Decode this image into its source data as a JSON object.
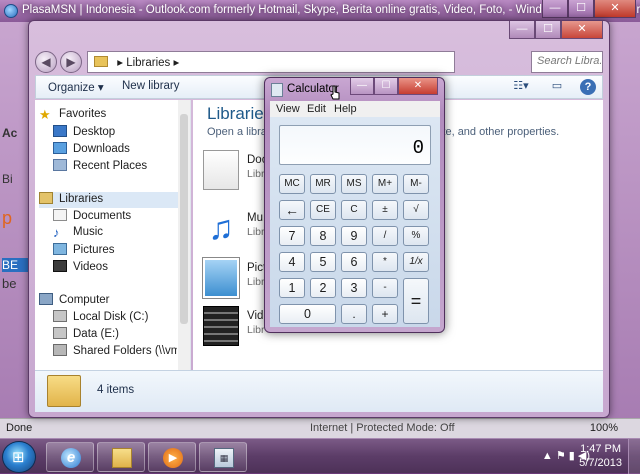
{
  "ie": {
    "title": "PlasaMSN | Indonesia - Outlook.com formerly Hotmail, Skype, Berita online gratis, Video, Foto,  - Windows Internet Explorer",
    "buttons": {
      "minimize": "—",
      "maximize": "☐",
      "close": "✕"
    },
    "left_fragments": [
      "Ac",
      "Bi",
      "p",
      "BE",
      "be"
    ],
    "status": {
      "left": "Done",
      "zone": "Internet | Protected Mode: Off",
      "zoom": "100%"
    }
  },
  "explorer": {
    "buttons": {
      "minimize": "—",
      "maximize": "☐",
      "close": "✕"
    },
    "nav": {
      "back": "◀",
      "forward": "▶"
    },
    "address": {
      "chevron": "▸",
      "path": "Libraries",
      "trail": "▸"
    },
    "search_placeholder": "Search Libra...",
    "toolbar": {
      "organize": "Organize ▾",
      "new_library": "New library",
      "view_icon": "view-icon",
      "pane_icon": "preview-pane-icon",
      "help": "?"
    },
    "navpane": {
      "favorites": "Favorites",
      "fav_items": [
        "Desktop",
        "Downloads",
        "Recent Places"
      ],
      "libraries": "Libraries",
      "lib_items": [
        "Documents",
        "Music",
        "Pictures",
        "Videos"
      ],
      "computer": "Computer",
      "comp_items": [
        "Local Disk (C:)",
        "Data (E:)",
        "Shared Folders (\\\\vmwa"
      ]
    },
    "content": {
      "title": "Libraries",
      "subtitle": "Open a library",
      "subtitle_right": "r, date, and other properties.",
      "items": [
        {
          "name": "Doc",
          "sub": "Libr"
        },
        {
          "name": "Mu",
          "sub": "Libr"
        },
        {
          "name": "Pict",
          "sub": "Libr"
        },
        {
          "name": "Vid",
          "sub": "Libr"
        }
      ]
    },
    "details": {
      "count": "4 items"
    }
  },
  "calculator": {
    "title": "Calculator",
    "buttons": {
      "minimize": "—",
      "maximize": "☐",
      "close": "✕"
    },
    "menu": [
      "View",
      "Edit",
      "Help"
    ],
    "display": "0",
    "keys": {
      "row1": [
        "MC",
        "MR",
        "MS",
        "M+",
        "M-"
      ],
      "row2": [
        "←",
        "CE",
        "C",
        "±",
        "√"
      ],
      "row3": [
        "7",
        "8",
        "9",
        "/",
        "%"
      ],
      "row4": [
        "4",
        "5",
        "6",
        "*",
        "1/x"
      ],
      "row5": [
        "1",
        "2",
        "3",
        "-"
      ],
      "row6": [
        "0",
        ".",
        "+"
      ],
      "equals": "="
    }
  },
  "taskbar": {
    "start": "⊞",
    "apps": [
      "internet-explorer-icon",
      "windows-explorer-icon",
      "media-player-icon",
      "calculator-icon"
    ],
    "media_glyph": "▶",
    "calc_glyph": "▦",
    "ie_glyph": "e",
    "tray": "▲  ⚑  ▮  ◀)",
    "time": "1:47 PM",
    "date": "5/7/2013"
  }
}
